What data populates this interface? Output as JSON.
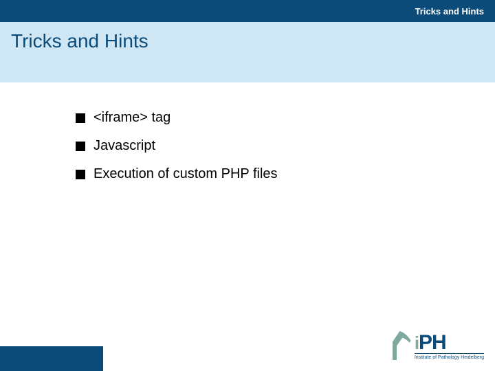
{
  "header": {
    "breadcrumb": "Tricks and Hints"
  },
  "slide": {
    "title": "Tricks and Hints"
  },
  "bullets": [
    "<iframe> tag",
    "Javascript",
    "Execution of custom PHP files"
  ],
  "logo": {
    "lowercase": "i",
    "uppercase": "PH",
    "subtitle": "Institute of Pathology Heidelberg"
  }
}
